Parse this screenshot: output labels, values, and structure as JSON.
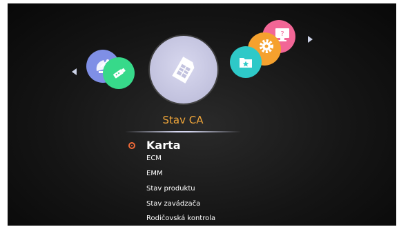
{
  "header": {
    "section_title": "Stav CA"
  },
  "carousel": {
    "items": [
      {
        "name": "satellite",
        "icon": "satellite-dish-icon",
        "color": "#7f8fe6"
      },
      {
        "name": "usb",
        "icon": "usb-icon",
        "color": "#37d98a"
      },
      {
        "name": "ca-status",
        "icon": "smartcard-icon",
        "color": "#c2c2de",
        "selected": true
      },
      {
        "name": "folder",
        "icon": "folder-star-icon",
        "color": "#2ec9c8"
      },
      {
        "name": "settings",
        "icon": "gear-icon",
        "color": "#f5a12e"
      },
      {
        "name": "computer",
        "icon": "computer-help-icon",
        "color": "#f26696"
      }
    ]
  },
  "menu": {
    "selected_index": 0,
    "items": [
      {
        "label": "Karta"
      },
      {
        "label": "ECM"
      },
      {
        "label": "EMM"
      },
      {
        "label": "Stav produktu"
      },
      {
        "label": "Stav zavádzača"
      },
      {
        "label": "Rodičovská kontrola"
      }
    ]
  },
  "colors": {
    "accent": "#f0a63a",
    "selection_marker": "#f06a38",
    "background": "#151515"
  }
}
